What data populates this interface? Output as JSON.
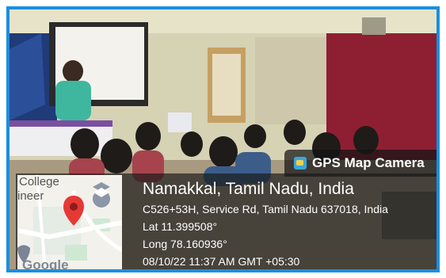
{
  "badge": {
    "icon": "map-camera-icon",
    "label": "GPS Map Camera"
  },
  "location": {
    "city": "Namakkal, Tamil Nadu, India",
    "address": "C526+53H, Service Rd, Tamil Nadu 637018, India",
    "lat": "Lat 11.399508°",
    "long": "Long 78.160936°",
    "datetime": "08/10/22 11:37 AM GMT +05:30"
  },
  "map": {
    "label_top": "College",
    "label_left": "ineer",
    "logo": "Google",
    "pin_color": "#e53935"
  },
  "colors": {
    "frame": "#1a8fe0"
  }
}
